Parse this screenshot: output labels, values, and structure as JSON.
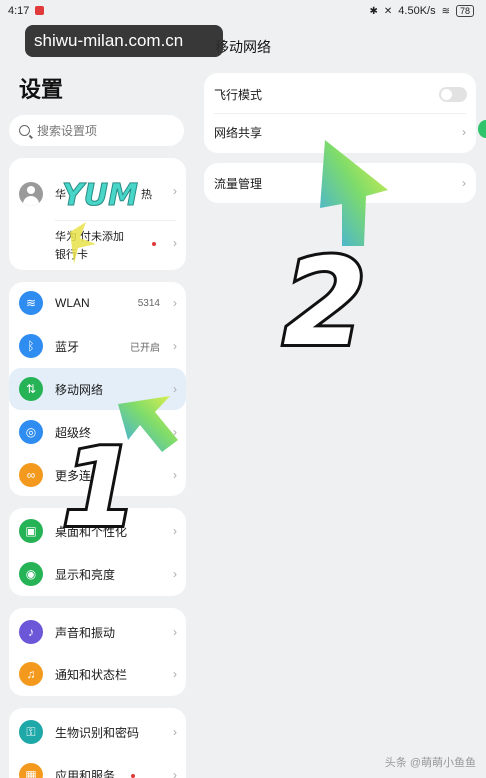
{
  "status_bar": {
    "time": "4:17",
    "net_speed": "4.50K/s",
    "battery": "78"
  },
  "watermark": {
    "text": "shiwu-milan.com.cn"
  },
  "settings": {
    "title": "设置",
    "search_placeholder": "搜索设置项",
    "account": {
      "line1_visible_start": "华",
      "line1_visible_end": "热",
      "line2_partial": "华为  付未添加",
      "line3_partial": "银行卡"
    },
    "network_items": [
      {
        "label": "WLAN",
        "value": "5314",
        "icon": "wifi-icon",
        "color": "#2f8cf0"
      },
      {
        "label": "蓝牙",
        "value": "已开启",
        "icon": "bluetooth-icon",
        "color": "#2f8cf0"
      },
      {
        "label": "移动网络",
        "value": "",
        "icon": "mobile-network-icon",
        "color": "#25b356"
      },
      {
        "label": "超级终",
        "value": "",
        "icon": "super-device-icon",
        "color": "#2f8cf0"
      },
      {
        "label": "更多连",
        "value": "",
        "icon": "link-icon",
        "color": "#f39a1e"
      }
    ],
    "display_items": [
      {
        "label": "桌面和个性化",
        "icon": "wallpaper-icon",
        "color": "#25b356"
      },
      {
        "label": "显示和亮度",
        "icon": "eye-icon",
        "color": "#25b356"
      }
    ],
    "sound_items": [
      {
        "label": "声音和振动",
        "icon": "speaker-icon",
        "color": "#6b57d8"
      },
      {
        "label": "通知和状态栏",
        "icon": "bell-icon",
        "color": "#f39a1e"
      }
    ],
    "security_items": [
      {
        "label": "生物识别和密码",
        "icon": "key-icon",
        "color": "#1fa8a8"
      },
      {
        "label": "应用和服务",
        "icon": "apps-icon",
        "color": "#f39a1e"
      }
    ]
  },
  "mobile_network": {
    "title": "移动网络",
    "airplane_mode": "飞行模式",
    "hotspot": "网络共享",
    "data_usage": "流量管理"
  },
  "annotations": {
    "step1": "1",
    "step2": "2",
    "sticker": "YUM"
  },
  "corner_watermark": "头条 @萌萌小鱼鱼"
}
